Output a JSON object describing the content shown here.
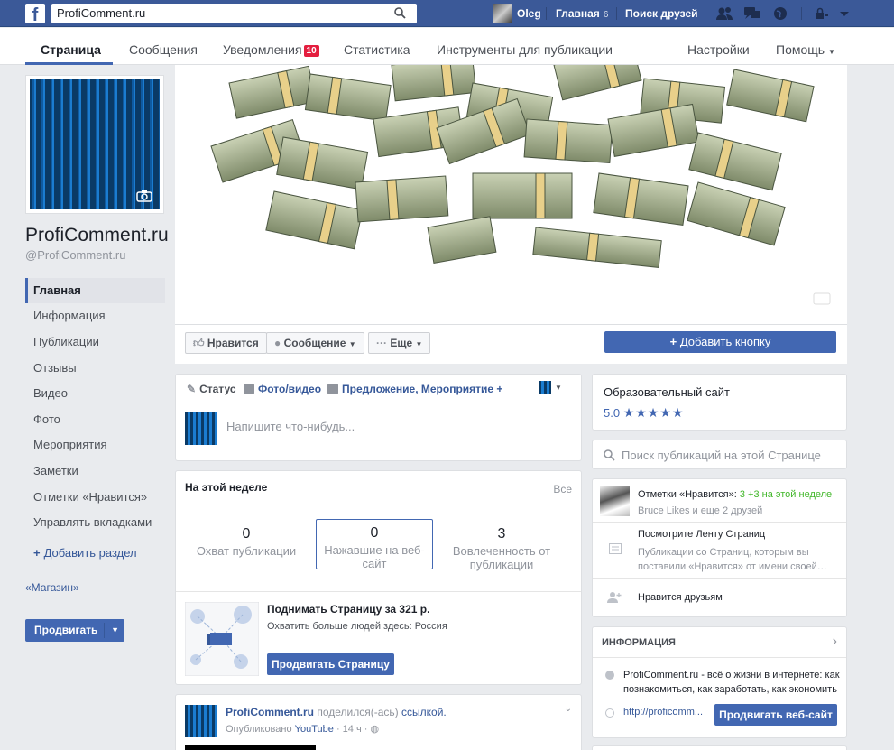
{
  "topbar": {
    "search_value": "ProfiComment.ru",
    "user_name": "Oleg",
    "home_label": "Главная",
    "home_count": "6",
    "find_friends_label": "Поиск друзей"
  },
  "page_nav": {
    "tabs": [
      "Страница",
      "Сообщения",
      "Уведомления",
      "Статистика",
      "Инструменты для публикации"
    ],
    "notifications_badge": "10",
    "settings_label": "Настройки",
    "help_label": "Помощь"
  },
  "page": {
    "name": "ProfiComment.ru",
    "handle": "@ProfiComment.ru"
  },
  "left_nav": {
    "items": [
      "Главная",
      "Информация",
      "Публикации",
      "Отзывы",
      "Видео",
      "Фото",
      "Мероприятия",
      "Заметки",
      "Отметки «Нравится»",
      "Управлять вкладками"
    ],
    "add_section_label": "Добавить раздел",
    "shop_label": "«Магазин»",
    "promote_label": "Продвигать"
  },
  "actions": {
    "like_label": "Нравится",
    "message_label": "Сообщение",
    "more_label": "Еще",
    "add_button_label": "Добавить кнопку"
  },
  "composer": {
    "status_label": "Статус",
    "photo_label": "Фото/видео",
    "offer_label": "Предложение, Мероприятие +",
    "placeholder": "Напишите что-нибудь..."
  },
  "this_week": {
    "title": "На этой неделе",
    "all_label": "Все",
    "stats": [
      {
        "value": "0",
        "label": "Охват публикации"
      },
      {
        "value": "0",
        "label": "Нажавшие на веб-сайт"
      },
      {
        "value": "3",
        "label": "Вовлеченность от публикации"
      }
    ],
    "boost_title": "Поднимать Страницу за 321 р.",
    "boost_subtitle": "Охватить больше людей здесь: Россия",
    "boost_button": "Продвигать Страницу"
  },
  "post": {
    "author": "ProfiComment.ru",
    "shared_text": "поделился(-ась)",
    "link_text": "ссылкой.",
    "published_prefix": "Опубликовано",
    "published_via": "YouTube",
    "time": "14 ч"
  },
  "right": {
    "category": "Образовательный сайт",
    "rating": "5.0",
    "stars": "★★★★★",
    "search_placeholder": "Поиск публикаций на этой Странице",
    "likes_label": "Отметки «Нравится»:",
    "likes_count": "3",
    "likes_week": "+3 на этой неделе",
    "likes_friends": "Bruce Likes и еще 2 друзей",
    "feed_title": "Посмотрите Ленту Страниц",
    "feed_desc": "Публикации со Страниц, которым вы поставили «Нравится» от имени своей…",
    "friends_like": "Нравится друзьям",
    "info_title": "ИНФОРМАЦИЯ",
    "info_desc": "ProfiComment.ru - всё о жизни в интернете: как познакомиться, как заработать, как экономить",
    "info_url": "http://proficomm...",
    "website_button": "Продвигать веб-сайт"
  },
  "colors": {
    "brand": "#3b5998",
    "accent": "#4267b2",
    "badge": "#e41e3f"
  }
}
